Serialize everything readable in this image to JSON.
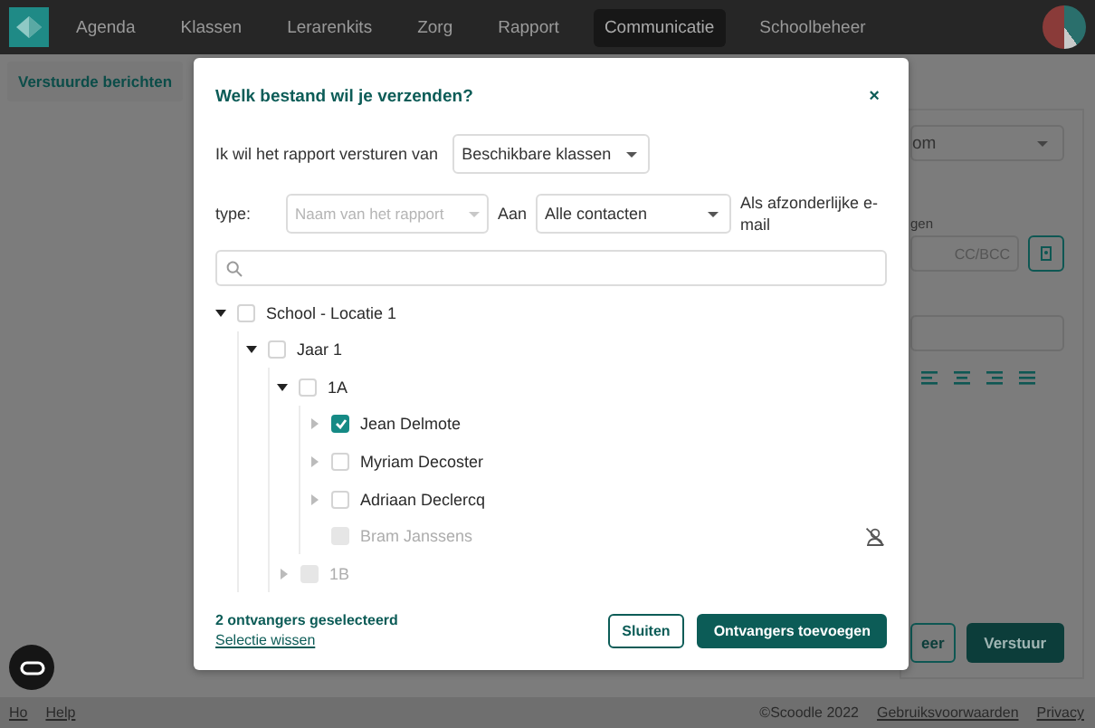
{
  "nav": {
    "items": [
      {
        "label": "Agenda",
        "selected": false
      },
      {
        "label": "Klassen",
        "selected": false
      },
      {
        "label": "Lerarenkits",
        "selected": false
      },
      {
        "label": "Zorg",
        "selected": false
      },
      {
        "label": "Rapport",
        "selected": false
      },
      {
        "label": "Communicatie",
        "selected": true
      },
      {
        "label": "Schoolbeheer",
        "selected": false
      }
    ]
  },
  "subnav": {
    "tab": "Verstuurde berichten"
  },
  "background": {
    "dropdown_value": "om",
    "field_label": "gen",
    "cc_placeholder": "CC/BCC",
    "secondary_button": "eer",
    "send_button": "Verstuur"
  },
  "dialog": {
    "title": "Welk bestand wil je verzenden?",
    "close": "×",
    "source_label": "Ik wil het rapport versturen van",
    "source_select": "Beschikbare klassen",
    "type_label": "type:",
    "report_placeholder": "Naam van het rapport",
    "to_label": "Aan",
    "to_select": "Alle contacten",
    "separate_label": "Als afzonderlijke e-mail",
    "tree": [
      {
        "label": "School - Locatie 1",
        "checked": false,
        "disabled": false,
        "expanded": true,
        "children": [
          {
            "label": "Jaar 1",
            "checked": false,
            "disabled": false,
            "expanded": true,
            "children": [
              {
                "label": "1A",
                "checked": false,
                "disabled": false,
                "expanded": true,
                "children": [
                  {
                    "label": "Jean Delmote",
                    "checked": true,
                    "disabled": false,
                    "expanded": false
                  },
                  {
                    "label": "Myriam Decoster",
                    "checked": false,
                    "disabled": false,
                    "expanded": false
                  },
                  {
                    "label": "Adriaan Declercq",
                    "checked": false,
                    "disabled": false,
                    "expanded": false
                  },
                  {
                    "label": "Bram Janssens",
                    "checked": false,
                    "disabled": true,
                    "no_contact": true
                  }
                ]
              },
              {
                "label": "1B",
                "checked": false,
                "disabled": true,
                "expanded": false
              }
            ]
          }
        ]
      }
    ],
    "summary": "2 ontvangers geselecteerd",
    "clear_link": "Selectie wissen",
    "close_button": "Sluiten",
    "add_button": "Ontvangers toevoegen"
  },
  "footer": {
    "links": [
      "Ho",
      "Help"
    ],
    "copyright": "©Scoodle 2022",
    "right_links": [
      "Gebruiksvoorwaarden",
      "Privacy"
    ]
  }
}
